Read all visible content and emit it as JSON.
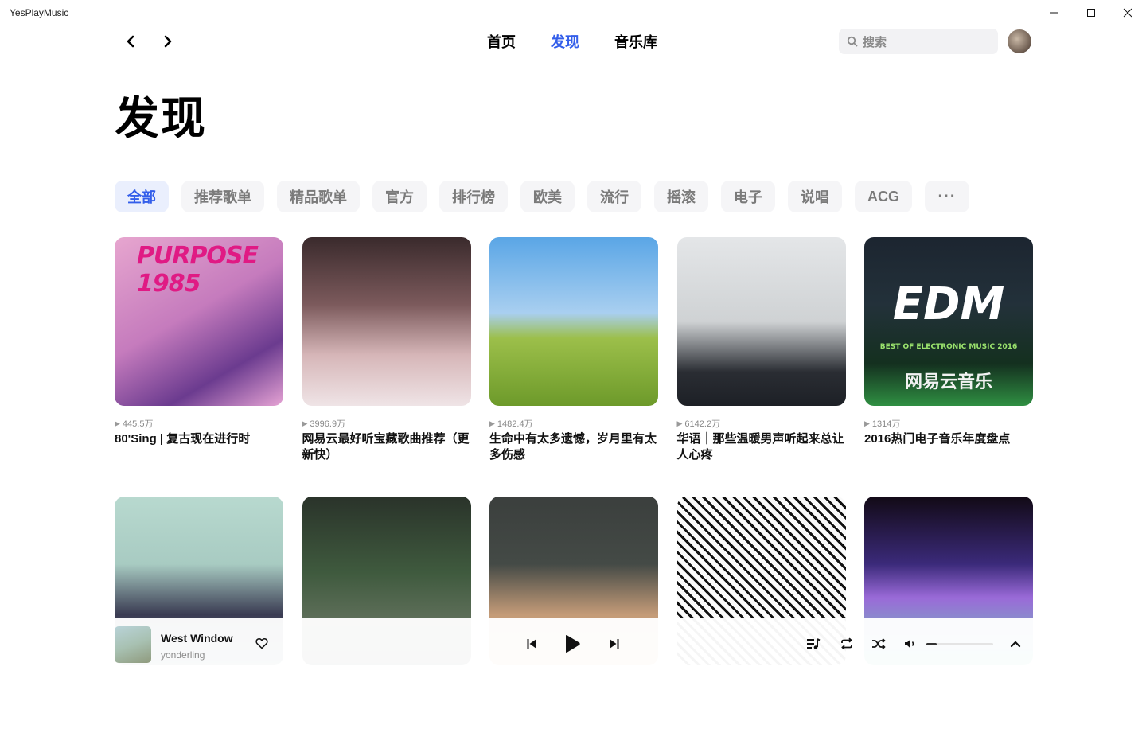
{
  "app": {
    "title": "YesPlayMusic"
  },
  "nav": {
    "links": [
      {
        "label": "首页",
        "active": false
      },
      {
        "label": "发现",
        "active": true
      },
      {
        "label": "音乐库",
        "active": false
      }
    ],
    "search_placeholder": "搜索"
  },
  "page": {
    "title": "发现"
  },
  "categories": [
    {
      "label": "全部",
      "active": true
    },
    {
      "label": "推荐歌单"
    },
    {
      "label": "精品歌单"
    },
    {
      "label": "官方"
    },
    {
      "label": "排行榜"
    },
    {
      "label": "欧美"
    },
    {
      "label": "流行"
    },
    {
      "label": "摇滚"
    },
    {
      "label": "电子"
    },
    {
      "label": "说唱"
    },
    {
      "label": "ACG"
    },
    {
      "label": "···"
    }
  ],
  "playlists": [
    {
      "plays": "445.5万",
      "title": "80'Sing | 复古现在进行时",
      "cover_text": "PURPOSE 1985"
    },
    {
      "plays": "3996.9万",
      "title": "网易云最好听宝藏歌曲推荐（更新快）"
    },
    {
      "plays": "1482.4万",
      "title": "生命中有太多遗憾，岁月里有太多伤感"
    },
    {
      "plays": "6142.2万",
      "title": "华语｜那些温暖男声听起来总让人心疼"
    },
    {
      "plays": "1314万",
      "title": "2016热门电子音乐年度盘点",
      "cover_text": "EDM",
      "cover_sub": "BEST OF ELECTRONIC MUSIC 2016",
      "cover_brand": "网易云音乐"
    },
    {
      "plays": "",
      "title": ""
    },
    {
      "plays": "",
      "title": ""
    },
    {
      "plays": "",
      "title": ""
    },
    {
      "plays": "",
      "title": ""
    },
    {
      "plays": "",
      "title": ""
    }
  ],
  "player": {
    "track": "West Window",
    "artist": "yonderling",
    "volume": 0.15
  },
  "colors": {
    "accent": "#335eea"
  }
}
